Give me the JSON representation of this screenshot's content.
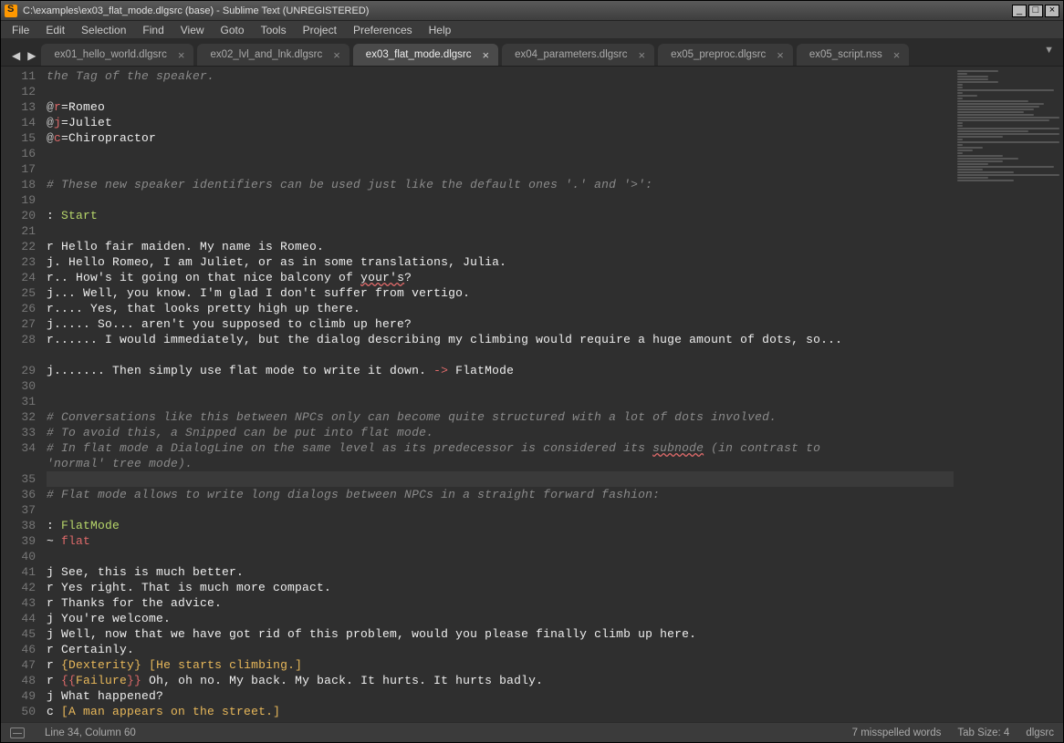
{
  "window": {
    "title": "C:\\examples\\ex03_flat_mode.dlgsrc (base) - Sublime Text (UNREGISTERED)"
  },
  "menu": [
    "File",
    "Edit",
    "Selection",
    "Find",
    "View",
    "Goto",
    "Tools",
    "Project",
    "Preferences",
    "Help"
  ],
  "tabs": [
    {
      "label": "ex01_hello_world.dlgsrc",
      "active": false
    },
    {
      "label": "ex02_lvl_and_lnk.dlgsrc",
      "active": false
    },
    {
      "label": "ex03_flat_mode.dlgsrc",
      "active": true
    },
    {
      "label": "ex04_parameters.dlgsrc",
      "active": false
    },
    {
      "label": "ex05_preproc.dlgsrc",
      "active": false
    },
    {
      "label": "ex05_script.nss",
      "active": false
    }
  ],
  "editor": {
    "first_line_number": 11,
    "highlight_line_index": 24,
    "lines": [
      {
        "segs": [
          {
            "t": "the Tag of the speaker.",
            "c": "c-comment"
          }
        ]
      },
      {
        "segs": [
          {
            "t": ""
          }
        ]
      },
      {
        "segs": [
          {
            "t": "@",
            "c": "c-at"
          },
          {
            "t": "r",
            "c": "c-key"
          },
          {
            "t": "=Romeo"
          }
        ]
      },
      {
        "segs": [
          {
            "t": "@",
            "c": "c-at"
          },
          {
            "t": "j",
            "c": "c-key"
          },
          {
            "t": "=Juliet"
          }
        ]
      },
      {
        "segs": [
          {
            "t": "@",
            "c": "c-at"
          },
          {
            "t": "c",
            "c": "c-key"
          },
          {
            "t": "=Chiropractor"
          }
        ]
      },
      {
        "segs": [
          {
            "t": ""
          }
        ]
      },
      {
        "segs": [
          {
            "t": ""
          }
        ]
      },
      {
        "segs": [
          {
            "t": "# These new speaker identifiers can be used just like the default ones '.' and '>':",
            "c": "c-comment"
          }
        ]
      },
      {
        "segs": [
          {
            "t": ""
          }
        ]
      },
      {
        "segs": [
          {
            "t": ": "
          },
          {
            "t": "Start",
            "c": "c-def"
          }
        ]
      },
      {
        "segs": [
          {
            "t": ""
          }
        ]
      },
      {
        "segs": [
          {
            "t": "r Hello fair maiden. My name is Romeo."
          }
        ]
      },
      {
        "segs": [
          {
            "t": "j. Hello Romeo, I am Juliet, or as in some translations, Julia."
          }
        ]
      },
      {
        "segs": [
          {
            "t": "r.. How's it going on that nice balcony of "
          },
          {
            "t": "your's",
            "c": "c-squig"
          },
          {
            "t": "?"
          }
        ]
      },
      {
        "segs": [
          {
            "t": "j... Well, you know. I'm glad I don't suffer from vertigo."
          }
        ]
      },
      {
        "segs": [
          {
            "t": "r.... Yes, that looks pretty high up there."
          }
        ]
      },
      {
        "segs": [
          {
            "t": "j..... So... aren't you supposed to climb up here?"
          }
        ]
      },
      {
        "segs": [
          {
            "t": "r...... I would immediately, but the dialog describing my climbing would require a huge amount of dots, so..."
          }
        ]
      },
      {
        "segs": [
          {
            "t": "j....... Then simply use flat mode to write it down. "
          },
          {
            "t": "->",
            "c": "c-arrow"
          },
          {
            "t": " FlatMode"
          }
        ]
      },
      {
        "segs": [
          {
            "t": ""
          }
        ]
      },
      {
        "segs": [
          {
            "t": ""
          }
        ]
      },
      {
        "segs": [
          {
            "t": "# Conversations like this between NPCs only can become quite structured with a lot of dots involved.",
            "c": "c-comment"
          }
        ]
      },
      {
        "segs": [
          {
            "t": "# To avoid this, a Snipped can be put into flat mode.",
            "c": "c-comment"
          }
        ]
      },
      {
        "segs": [
          {
            "t": "# In flat mode a DialogLine on the same level as its predecessor is considered its ",
            "c": "c-comment"
          },
          {
            "t": "subnode",
            "c": "c-comment c-squig"
          },
          {
            "t": " (in contrast to 'normal' tree mode).",
            "c": "c-comment"
          }
        ]
      },
      {
        "segs": [
          {
            "t": ""
          }
        ]
      },
      {
        "segs": [
          {
            "t": "# Flat mode allows to write long dialogs between NPCs in a straight forward fashion:",
            "c": "c-comment"
          }
        ]
      },
      {
        "segs": [
          {
            "t": ""
          }
        ]
      },
      {
        "segs": [
          {
            "t": ": "
          },
          {
            "t": "FlatMode",
            "c": "c-def"
          }
        ]
      },
      {
        "segs": [
          {
            "t": "~ "
          },
          {
            "t": "flat",
            "c": "c-dir"
          }
        ]
      },
      {
        "segs": [
          {
            "t": ""
          }
        ]
      },
      {
        "segs": [
          {
            "t": "j See, this is much better."
          }
        ]
      },
      {
        "segs": [
          {
            "t": "r Yes right. That is much more compact."
          }
        ]
      },
      {
        "segs": [
          {
            "t": "r Thanks for the advice."
          }
        ]
      },
      {
        "segs": [
          {
            "t": "j You're welcome."
          }
        ]
      },
      {
        "segs": [
          {
            "t": "j Well, now that we have got rid of this problem, would you please finally climb up here."
          }
        ]
      },
      {
        "segs": [
          {
            "t": "r Certainly."
          }
        ]
      },
      {
        "segs": [
          {
            "t": "r "
          },
          {
            "t": "{",
            "c": "c-brace"
          },
          {
            "t": "Dexterity",
            "c": "c-brace"
          },
          {
            "t": "}",
            "c": "c-brace"
          },
          {
            "t": " "
          },
          {
            "t": "[",
            "c": "c-sq"
          },
          {
            "t": "He starts climbing.",
            "c": "c-sq"
          },
          {
            "t": "]",
            "c": "c-sq"
          }
        ]
      },
      {
        "segs": [
          {
            "t": "r "
          },
          {
            "t": "{{",
            "c": "c-dbrace"
          },
          {
            "t": "Failure",
            "c": "c-brace"
          },
          {
            "t": "}}",
            "c": "c-dbrace"
          },
          {
            "t": " Oh, oh no. My back. My back. It hurts. It hurts badly."
          }
        ]
      },
      {
        "segs": [
          {
            "t": "j What happened?"
          }
        ]
      },
      {
        "segs": [
          {
            "t": "c "
          },
          {
            "t": "[",
            "c": "c-sq"
          },
          {
            "t": "A man appears on the street.",
            "c": "c-sq"
          },
          {
            "t": "]",
            "c": "c-sq"
          }
        ]
      }
    ],
    "wrapped_indices": [
      17,
      23
    ]
  },
  "statusbar": {
    "pos": "Line 34, Column 60",
    "spell": "7 misspelled words",
    "tab": "Tab Size: 4",
    "syntax": "dlgsrc"
  }
}
